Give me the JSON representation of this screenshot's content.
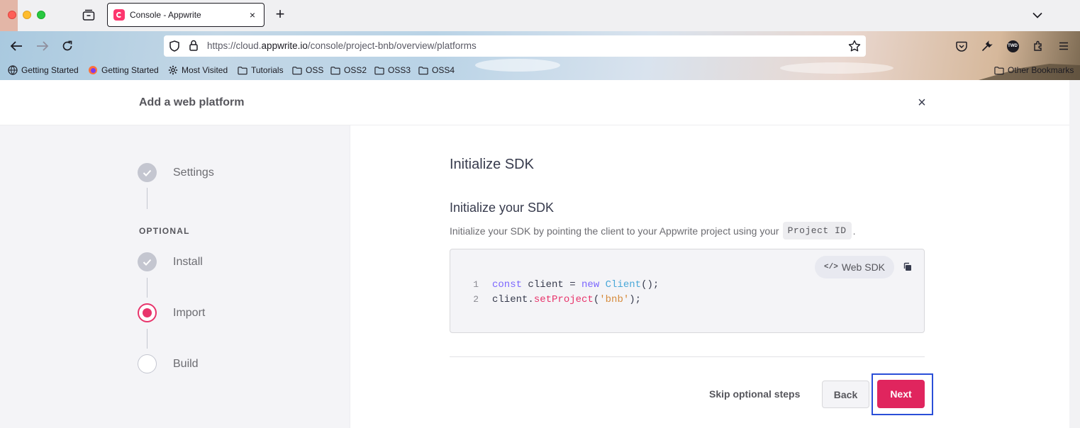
{
  "browser": {
    "tab": {
      "title": "Console - Appwrite",
      "close_icon": "×"
    },
    "new_tab_label": "+",
    "url_prefix": "https://cloud.",
    "url_domain": "appwrite.io",
    "url_path": "/console/project-bnb/overview/platforms",
    "bookmarks": [
      {
        "label": "Getting Started",
        "icon": "globe-icon"
      },
      {
        "label": "Getting Started",
        "icon": "firefox-icon"
      },
      {
        "label": "Most Visited",
        "icon": "gear-icon"
      },
      {
        "label": "Tutorials",
        "icon": "folder-icon"
      },
      {
        "label": "OSS",
        "icon": "folder-icon"
      },
      {
        "label": "OSS2",
        "icon": "folder-icon"
      },
      {
        "label": "OSS3",
        "icon": "folder-icon"
      },
      {
        "label": "OSS4",
        "icon": "folder-icon"
      }
    ],
    "other_bookmarks": "Other Bookmarks",
    "profile_initials": "TWD"
  },
  "modal": {
    "title": "Add a web platform",
    "close_label": "×",
    "steps": [
      {
        "label": "Settings",
        "state": "done"
      },
      {
        "label": "Install",
        "state": "done"
      },
      {
        "label": "Import",
        "state": "active"
      },
      {
        "label": "Build",
        "state": "pending"
      }
    ],
    "optional_label": "OPTIONAL",
    "heading": "Initialize SDK",
    "subheading": "Initialize your SDK",
    "description": "Initialize your SDK by pointing the client to your Appwrite project using your",
    "description_code": "Project ID",
    "description_end": ".",
    "sdk_pill_icon": "</>",
    "sdk_pill": "Web SDK",
    "code": {
      "line_numbers": [
        "1",
        "2"
      ],
      "line1": {
        "kw1": "const",
        "mid1": " client = ",
        "kw2": "new",
        "sp": " ",
        "cls": "Client",
        "end": "();"
      },
      "line2": {
        "obj": "client.",
        "fn": "setProject",
        "open": "(",
        "str": "'bnb'",
        "close": ");"
      }
    },
    "buttons": {
      "skip": "Skip optional steps",
      "back": "Back",
      "next": "Next"
    }
  },
  "colors": {
    "accent": "#e0255e",
    "focus_ring": "#2a4fd8",
    "done_step": "#c4c6d0"
  }
}
